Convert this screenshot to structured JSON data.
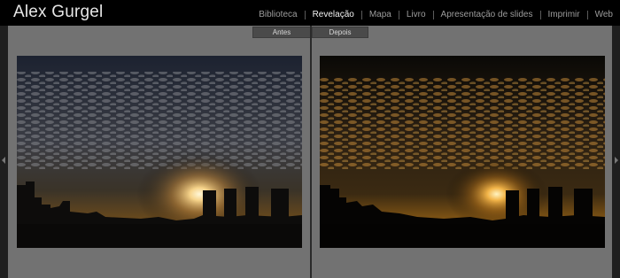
{
  "header": {
    "identity_plate": "Alex Gurgel",
    "modules": [
      {
        "label": "Biblioteca",
        "active": false
      },
      {
        "label": "Revelação",
        "active": true
      },
      {
        "label": "Mapa",
        "active": false
      },
      {
        "label": "Livro",
        "active": false
      },
      {
        "label": "Apresentação de slides",
        "active": false
      },
      {
        "label": "Imprimir",
        "active": false
      },
      {
        "label": "Web",
        "active": false
      }
    ]
  },
  "compare": {
    "before_label": "Antes",
    "after_label": "Depois"
  },
  "colors": {
    "topbar": "#000000",
    "pane_bg": "#727272",
    "active_module": "#f2f2f2",
    "inactive_module": "#9c9c9c"
  }
}
